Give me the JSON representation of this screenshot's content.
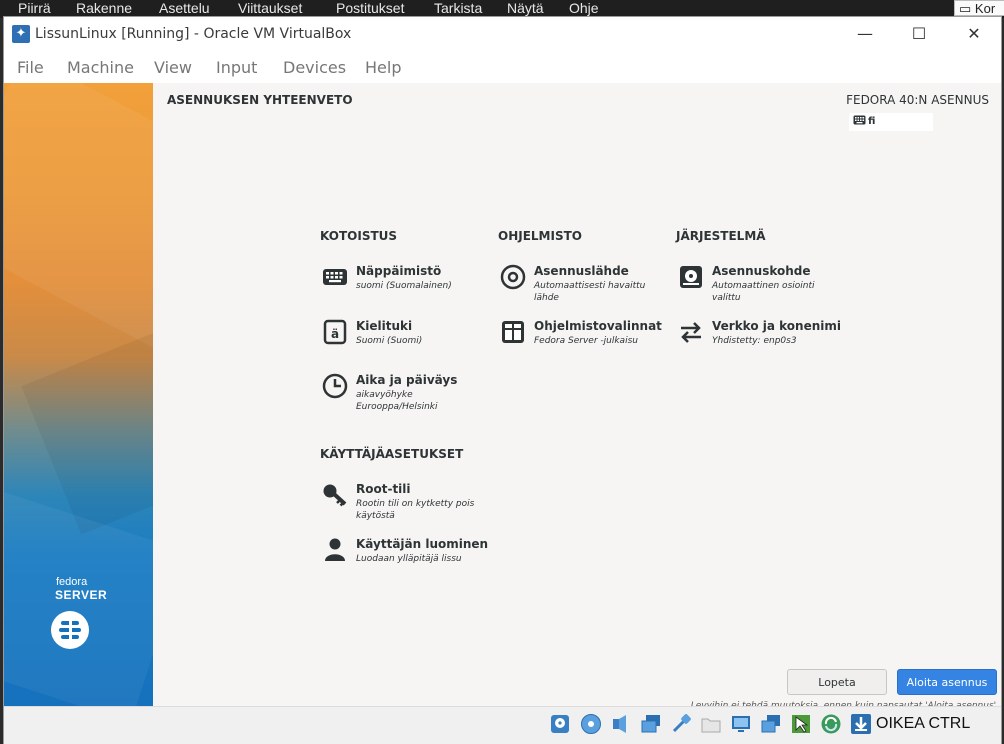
{
  "host_app": {
    "ribbon_tabs": [
      "Piirrä",
      "Rakenne",
      "Asettelu",
      "Viittaukset",
      "Postitukset",
      "Tarkista",
      "Näytä",
      "Ohje"
    ],
    "comments_label": "Kor"
  },
  "window": {
    "title": "LissunLinux [Running] - Oracle VM VirtualBox",
    "minimize_glyph": "—",
    "maximize_glyph": "☐",
    "close_glyph": "✕"
  },
  "menu": [
    "File",
    "Machine",
    "View",
    "Input",
    "Devices",
    "Help"
  ],
  "installer": {
    "page_title": "ASENNUKSEN YHTEENVETO",
    "product_title": "FEDORA 40:N ASENNUS",
    "keyboard_layout": "fi",
    "brand_line1": "fedora",
    "brand_line2": "SERVER",
    "sections": {
      "localization": "KOTOISTUS",
      "software": "OHJELMISTO",
      "system": "JÄRJESTELMÄ",
      "user_settings": "KÄYTTÄJÄASETUKSET"
    },
    "spokes": {
      "keyboard": {
        "name": "Näppäimistö",
        "status": "suomi (Suomalainen)",
        "icon": "keyboard-icon"
      },
      "language": {
        "name": "Kielituki",
        "status": "Suomi (Suomi)",
        "icon": "language-icon"
      },
      "time": {
        "name": "Aika ja päiväys",
        "status": "aikavyöhyke Eurooppa/Helsinki",
        "icon": "clock-icon"
      },
      "source": {
        "name": "Asennuslähde",
        "status": "Automaattisesti havaittu lähde",
        "icon": "disc-icon"
      },
      "software": {
        "name": "Ohjelmistovalinnat",
        "status": "Fedora Server -julkaisu",
        "icon": "package-icon"
      },
      "destination": {
        "name": "Asennuskohde",
        "status": "Automaattinen osiointi valittu",
        "icon": "harddisk-icon"
      },
      "network": {
        "name": "Verkko ja konenimi",
        "status": "Yhdistetty: enp0s3",
        "icon": "network-arrows-icon"
      },
      "root": {
        "name": "Root-tili",
        "status": "Rootin tili on kytketty pois käytöstä",
        "icon": "key-icon"
      },
      "user": {
        "name": "Käyttäjän luominen",
        "status": "Luodaan ylläpitäjä lissu",
        "icon": "user-icon"
      }
    },
    "buttons": {
      "quit": "Lopeta",
      "begin": "Aloita asennus"
    },
    "footnote": "Levyihin ei tehdä muutoksia, ennen kuin napsautat 'Aloita asennus'."
  },
  "statusbar": {
    "host_key": "OIKEA CTRL",
    "icons": [
      "harddisk-icon",
      "optical-drive-icon",
      "audio-icon",
      "network-icon",
      "usb-icon",
      "shared-folders-icon",
      "display-icon",
      "recording-icon",
      "mouse-integration-icon",
      "cpu-activity-icon",
      "download-icon"
    ]
  }
}
